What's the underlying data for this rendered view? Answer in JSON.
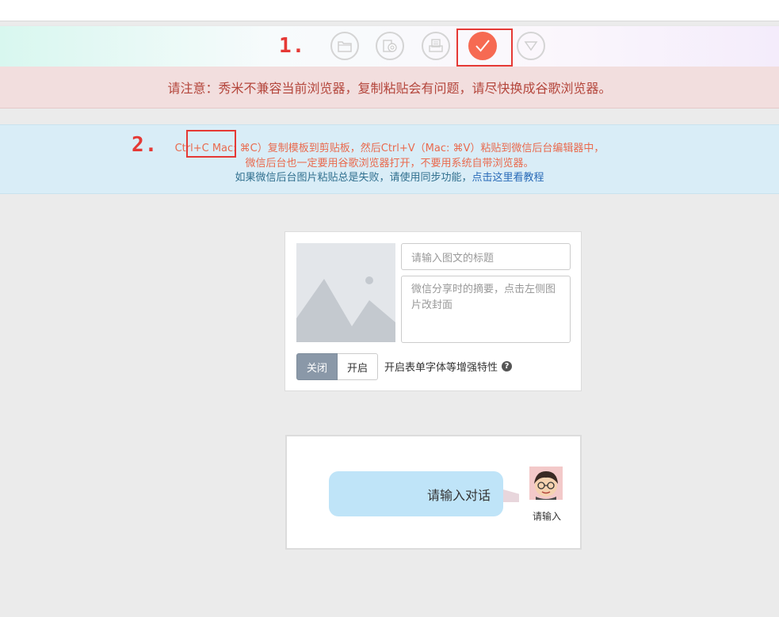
{
  "toolbar": {
    "step1": "1.",
    "buttons": [
      {
        "name": "folder-icon",
        "active": false
      },
      {
        "name": "media-icon",
        "active": false
      },
      {
        "name": "print-icon",
        "active": false
      },
      {
        "name": "check-icon",
        "active": true
      },
      {
        "name": "triangle-down-icon",
        "active": false
      }
    ],
    "accent": "#f66a52"
  },
  "warning": {
    "text": "请注意：秀米不兼容当前浏览器，复制粘贴会有问题，请尽快换成谷歌浏览器。"
  },
  "info": {
    "step2": "2.",
    "shortcut": "Ctrl+C",
    "line1_rest": " Mac: ⌘C）复制模板到剪贴板，然后Ctrl+V（Mac: ⌘V）粘贴到微信后台编辑器中，",
    "line2": "微信后台也一定要用谷歌浏览器打开，不要用系统自带浏览器。",
    "line3_text": "如果微信后台图片粘贴总是失败，请使用同步功能，",
    "line3_link": "点击这里看教程"
  },
  "card": {
    "title_placeholder": "请输入图文的标题",
    "summary_placeholder": "微信分享时的摘要，点击左侧图片改封面",
    "toggle_off": "关闭",
    "toggle_on": "开启",
    "enhance_label": "开启表单字体等增强特性"
  },
  "chat": {
    "bubble_text": "请输入对话",
    "avatar_name": "请输入"
  }
}
